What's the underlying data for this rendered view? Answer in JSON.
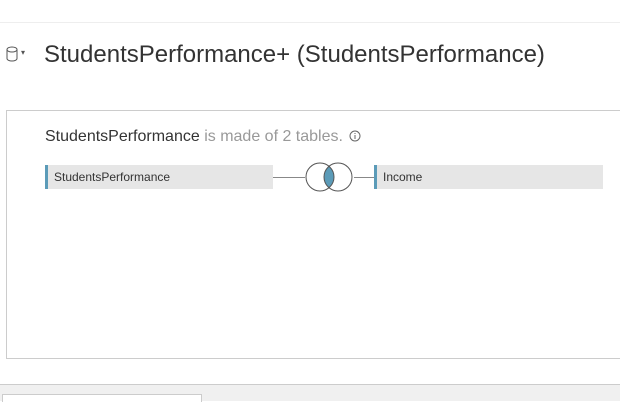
{
  "datasource": {
    "title": "StudentsPerformance+ (StudentsPerformance)",
    "icon": "database-icon",
    "caret": "▾"
  },
  "canvas": {
    "summary": {
      "table_name": "StudentsPerformance",
      "rest": " is made of 2 tables.",
      "info_icon": "info-icon"
    },
    "tables": [
      {
        "label": "StudentsPerformance"
      },
      {
        "label": "Income"
      }
    ],
    "join": {
      "icon": "inner-join-icon",
      "color": "#5b9bb8"
    }
  },
  "colors": {
    "accent": "#5b9bb8",
    "table_bg": "#e6e6e6",
    "muted_text": "#999999"
  }
}
